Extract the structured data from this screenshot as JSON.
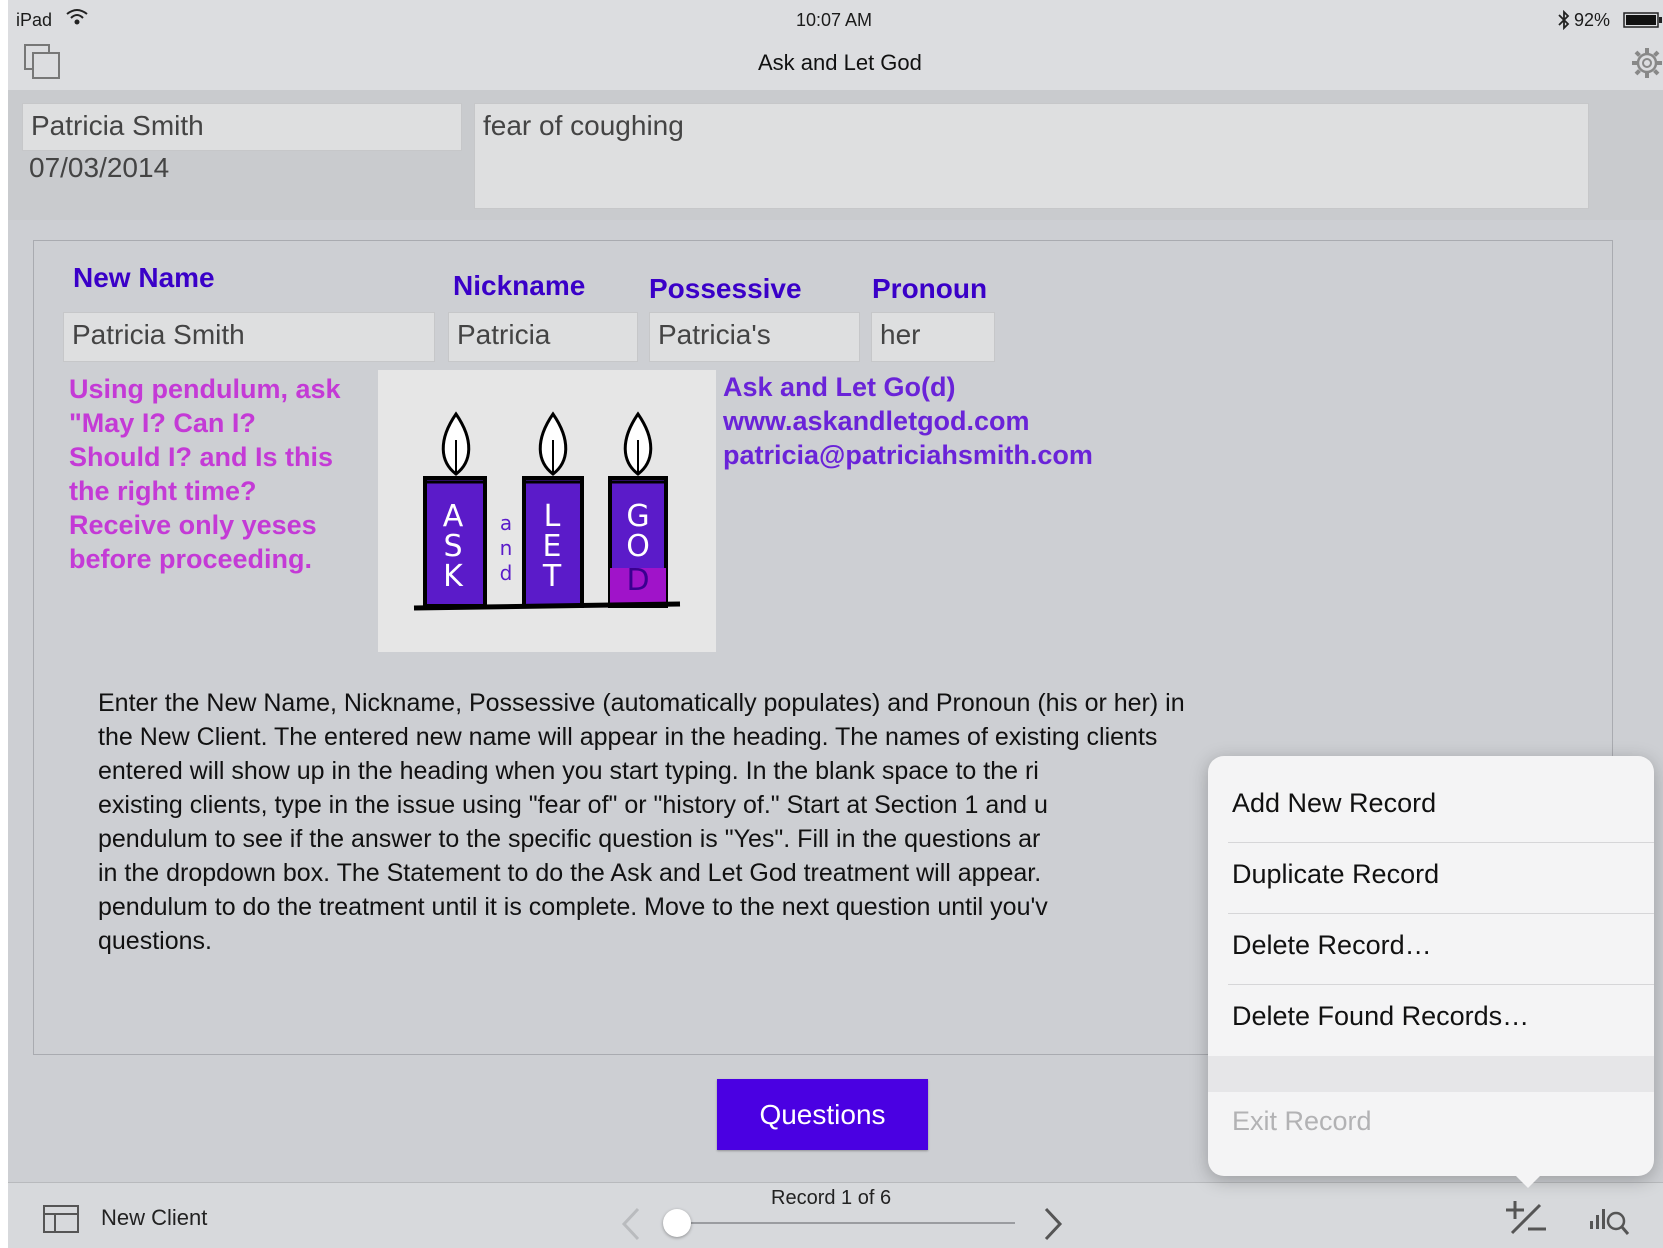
{
  "status_bar": {
    "device": "iPad",
    "time": "10:07 AM",
    "battery": "92%"
  },
  "title_bar": {
    "title": "Ask and Let God"
  },
  "header": {
    "client_name": "Patricia Smith",
    "date": "07/03/2014",
    "issue": "fear of coughing"
  },
  "form": {
    "new_name_label": "New Name",
    "nickname_label": "Nickname",
    "possessive_label": "Possessive",
    "pronoun_label": "Pronoun",
    "new_name_value": "Patricia Smith",
    "nickname_value": "Patricia",
    "possessive_value": "Patricia's",
    "pronoun_value": "her"
  },
  "pendulum_note": [
    "Using pendulum, ask",
    "\"May I? Can I?",
    "Should I? and Is this",
    "the right time?",
    "Receive only yeses",
    "before proceeding."
  ],
  "logo": {
    "candle1": [
      "A",
      "S",
      "K"
    ],
    "and": [
      "a",
      "n",
      "d"
    ],
    "candle2": [
      "L",
      "E",
      "T"
    ],
    "candle3": [
      "G",
      "O",
      "D"
    ]
  },
  "contact": {
    "name": "Ask and Let Go(d)",
    "website": "www.askandletgod.com",
    "email": "patricia@patriciahsmith.com"
  },
  "instructions": [
    "Enter the New Name, Nickname, Possessive (automatically populates) and Pronoun (his or her) in",
    "the New Client.  The entered new name will appear in the heading.  The names of existing clients",
    "entered will show up in the heading when you start typing.  In the blank space to the ri",
    "existing clients, type in the issue using \"fear of\" or \"history of.\"  Start at Section 1 and u",
    "pendulum to see if the answer to the specific question is \"Yes\".  Fill in the questions ar",
    "in the dropdown box.  The Statement to do the Ask and Let God treatment will appear.",
    "pendulum to do the treatment until it is complete.  Move to the next question until you'v",
    "questions."
  ],
  "questions_button": "Questions",
  "bottom_bar": {
    "layout_name": "New Client",
    "record_status": "Record 1 of 6",
    "slider_fraction": 0.0
  },
  "menu": {
    "items": [
      "Add New Record",
      "Duplicate Record",
      "Delete Record…",
      "Delete Found Records…"
    ],
    "disabled_item": "Exit Record"
  },
  "colors": {
    "label_blue": "#3a00c8",
    "note_magenta": "#c43ad6",
    "contact_purple": "#6a23d8",
    "button_purple": "#4a00e2"
  }
}
